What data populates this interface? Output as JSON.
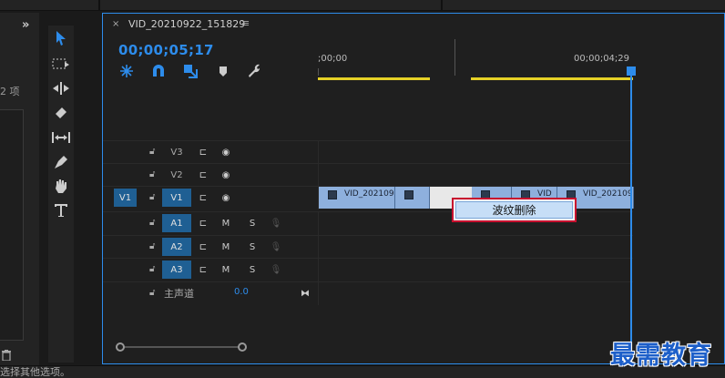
{
  "left_panel": {
    "count_text": "2 项",
    "status_text": "选择其他选项。"
  },
  "tools": [
    "selection-tool-icon",
    "track-select-tool-icon",
    "ripple-edit-tool-icon",
    "razor-tool-icon",
    "slip-tool-icon",
    "pen-tool-icon",
    "hand-tool-icon",
    "type-tool-icon"
  ],
  "timeline": {
    "close_glyph": "×",
    "sequence_name": "VID_20210922_151829",
    "menu_glyph": "≡",
    "timecode": "00;00;05;17",
    "ruler_start": ";00;00",
    "ruler_end": "00;00;04;29",
    "accent_color": "#2d8ceb",
    "workarea_color": "#e6d227"
  },
  "tracks": {
    "v3": {
      "name": "V3"
    },
    "v2": {
      "name": "V2"
    },
    "v1": {
      "name": "V1",
      "source": "V1"
    },
    "a1": {
      "name": "A1",
      "m": "M",
      "s": "S"
    },
    "a2": {
      "name": "A2",
      "m": "M",
      "s": "S"
    },
    "a3": {
      "name": "A3",
      "m": "M",
      "s": "S"
    },
    "master": {
      "name": "主声道",
      "value": "0.0"
    }
  },
  "clips": {
    "clip1": "VID_202109",
    "clip4": "VID",
    "clip5": "VID_202109"
  },
  "context_menu": {
    "ripple_delete": "波纹删除"
  },
  "watermark": "最需教育"
}
